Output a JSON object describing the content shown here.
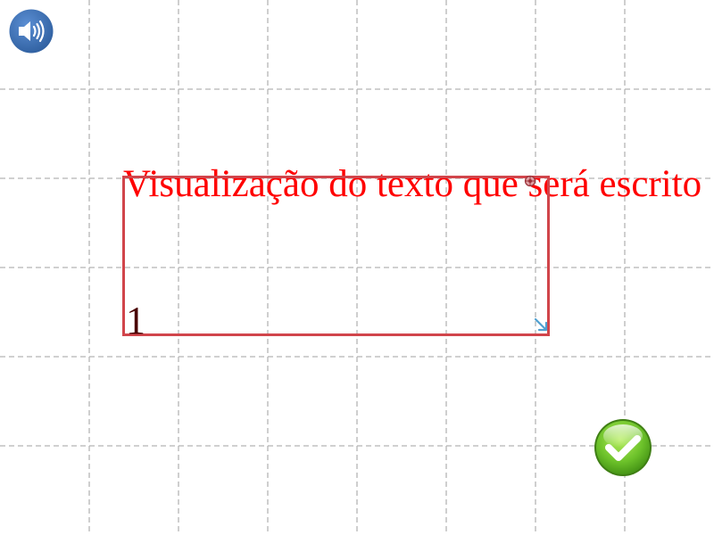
{
  "canvas": {
    "preview_text": "Visualização do texto que será escrito",
    "preview_text_color": "#ff0000",
    "box_number": "1",
    "box_border_color": "#d1454b",
    "grid_line_color": "#b5b5b5"
  },
  "toolbar": {
    "sound_icon": "speaker-icon",
    "sound_button_color": "#3c6fb4",
    "confirm_icon": "checkmark-icon",
    "confirm_button_color": "#6cc12a"
  }
}
